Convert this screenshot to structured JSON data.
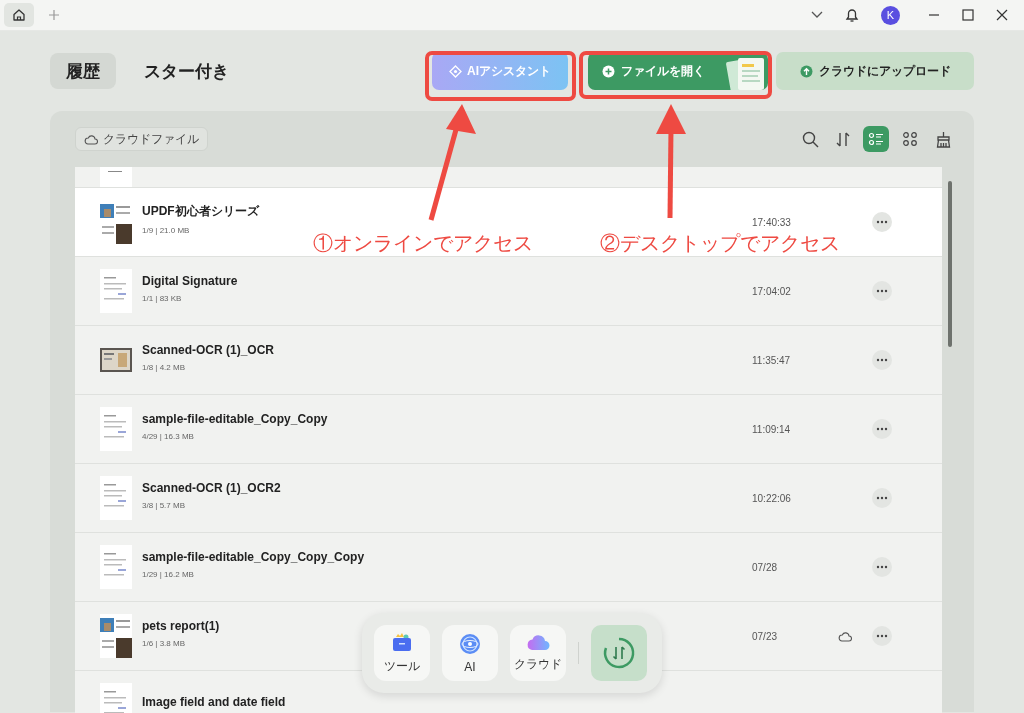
{
  "titlebar": {
    "avatar": "K"
  },
  "tabs": [
    {
      "label": "履歴",
      "selected": true
    },
    {
      "label": "スター付き",
      "selected": false
    }
  ],
  "actions": {
    "ai_button": "AIアシスタント",
    "open_button": "ファイルを開く",
    "upload_button": "クラウドにアップロード"
  },
  "panel": {
    "cloud_files": "クラウドファイル",
    "views": [
      {
        "kind": "list",
        "selected": true
      },
      {
        "kind": "grid",
        "selected": false
      }
    ]
  },
  "files": [
    {
      "name": "UPDF初心者シリーズ",
      "meta": "1/9 | 21.0 MB",
      "time": "17:40:33",
      "cloud": false,
      "selected": true
    },
    {
      "name": "Digital Signature",
      "meta": "1/1 | 83 KB",
      "time": "17:04:02",
      "cloud": false,
      "selected": false
    },
    {
      "name": "Scanned-OCR (1)_OCR",
      "meta": "1/8 | 4.2 MB",
      "time": "11:35:47",
      "cloud": false,
      "selected": false
    },
    {
      "name": "sample-file-editable_Copy_Copy",
      "meta": "4/29 | 16.3 MB",
      "time": "11:09:14",
      "cloud": false,
      "selected": false
    },
    {
      "name": "Scanned-OCR (1)_OCR2",
      "meta": "3/8 | 5.7 MB",
      "time": "10:22:06",
      "cloud": false,
      "selected": false
    },
    {
      "name": "sample-file-editable_Copy_Copy_Copy",
      "meta": "1/29 | 16.2 MB",
      "time": "07/28",
      "cloud": false,
      "selected": false
    },
    {
      "name": "pets report(1)",
      "meta": "1/6 | 3.8 MB",
      "time": "07/23",
      "cloud": true,
      "selected": false
    },
    {
      "name": "Image field and date field",
      "selected": false
    }
  ],
  "dock": [
    {
      "label": "ツール",
      "kind": "tools"
    },
    {
      "label": "AI",
      "kind": "ai"
    },
    {
      "label": "クラウド",
      "kind": "cloud"
    }
  ],
  "annotations": [
    {
      "text": "①オンラインでアクセス"
    },
    {
      "text": "②デスクトップでアクセス"
    }
  ]
}
